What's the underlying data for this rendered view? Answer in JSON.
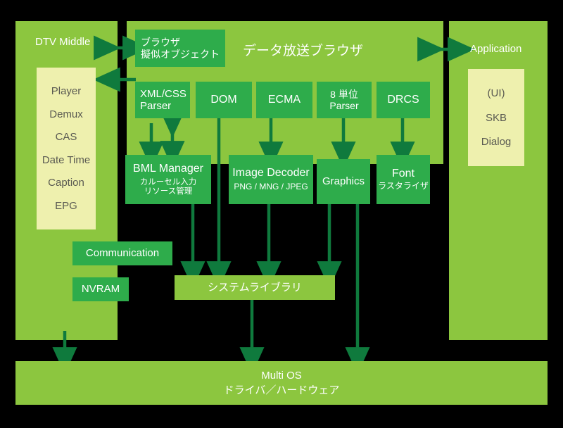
{
  "diagram": {
    "title_browser": "データ放送ブラウザ",
    "panels": {
      "dtv": {
        "title": "DTV Middle"
      },
      "application": {
        "title": "Application"
      }
    },
    "dtv_modules": [
      "Player",
      "Demux",
      "CAS",
      "Date Time",
      "Caption",
      "EPG"
    ],
    "application_modules": [
      "(UI)",
      "SKB",
      "Dialog"
    ],
    "browser_pseudo_object": {
      "line1": "ブラウザ",
      "line2": "擬似オブジェクト"
    },
    "parser_row": [
      {
        "line1": "XML/CSS",
        "line2": "Parser"
      },
      {
        "line1": "DOM",
        "line2": ""
      },
      {
        "line1": "ECMA",
        "line2": ""
      },
      {
        "line1": "8 単位",
        "line2": "Parser"
      },
      {
        "line1": "DRCS",
        "line2": ""
      }
    ],
    "component_row": [
      {
        "title": "BML Manager",
        "sub1": "カルーセル入力",
        "sub2": "リソース管理"
      },
      {
        "title": "Image Decoder",
        "sub1": "PNG / MNG / JPEG",
        "sub2": ""
      },
      {
        "title": "Graphics",
        "sub1": "",
        "sub2": ""
      },
      {
        "title": "Font",
        "sub1": "ラスタライザ",
        "sub2": ""
      }
    ],
    "communication": "Communication",
    "nvram": "NVRAM",
    "system_library": "システムライブラリ",
    "multi_os": {
      "line1": "Multi OS",
      "line2": "ドライバ／ハードウェア"
    },
    "colors": {
      "background": "#000000",
      "panel_green": "#8cc63f",
      "box_green": "#2eac4b",
      "list_cream": "#eef0ae",
      "arrow_green": "#0f7a3d",
      "text_white": "#ffffff",
      "text_gray": "#5a5a52"
    }
  }
}
